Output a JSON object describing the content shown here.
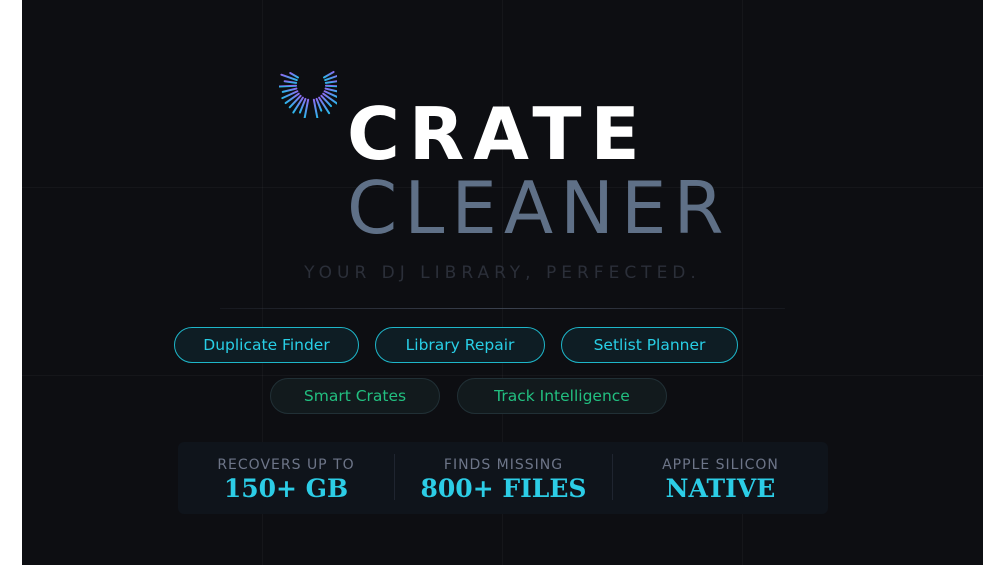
{
  "brand": {
    "logo_icon": "waveform-c-logo-icon",
    "title_line1": "CRATE",
    "title_line2": "CLEANER",
    "tagline": "YOUR DJ LIBRARY, PERFECTED.",
    "colors": {
      "background": "#0d0e12",
      "title_primary": "#ffffff",
      "title_secondary": "#5f7087",
      "accent_cyan": "#28cfe6",
      "accent_green": "#22bf80",
      "logo_gradient": [
        "#8a6cf0",
        "#2bb7ea"
      ]
    }
  },
  "features": {
    "primary": [
      {
        "label": "Duplicate Finder"
      },
      {
        "label": "Library Repair"
      },
      {
        "label": "Setlist Planner"
      }
    ],
    "secondary": [
      {
        "label": "Smart Crates"
      },
      {
        "label": "Track Intelligence"
      }
    ]
  },
  "stats": [
    {
      "label": "RECOVERS UP TO",
      "value": "150+ GB"
    },
    {
      "label": "FINDS MISSING",
      "value": "800+ FILES"
    },
    {
      "label": "APPLE SILICON",
      "value": "NATIVE"
    }
  ]
}
